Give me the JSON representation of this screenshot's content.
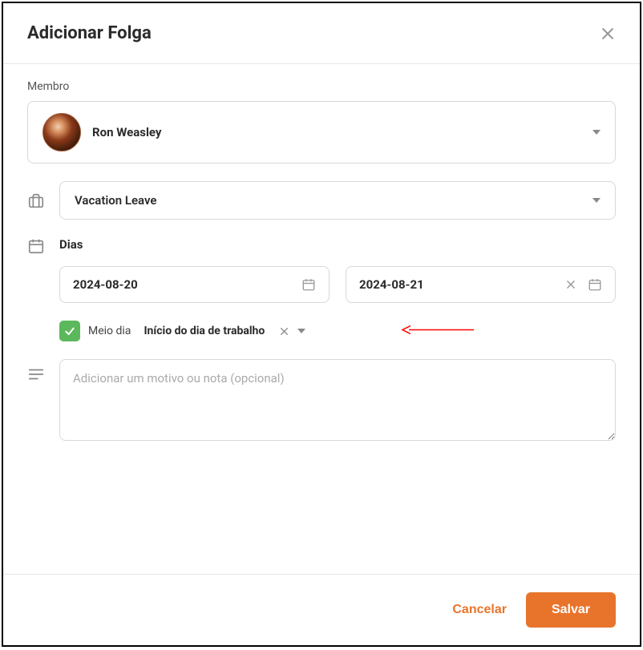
{
  "modal": {
    "title": "Adicionar Folga"
  },
  "member": {
    "label": "Membro",
    "name": "Ron Weasley"
  },
  "leave_type": {
    "name": "Vacation Leave"
  },
  "days": {
    "label": "Dias",
    "start": "2024-08-20",
    "end": "2024-08-21"
  },
  "half_day": {
    "checked": true,
    "label": "Meio dia",
    "option": "Início do dia de trabalho"
  },
  "notes": {
    "placeholder": "Adicionar um motivo ou nota (opcional)"
  },
  "footer": {
    "cancel": "Cancelar",
    "save": "Salvar"
  }
}
